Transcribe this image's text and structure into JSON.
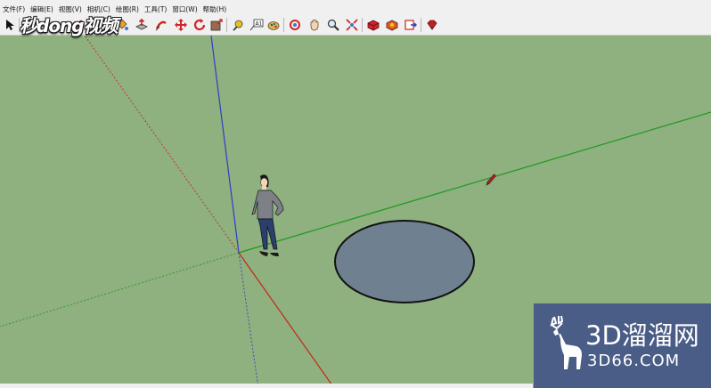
{
  "menu": {
    "items": [
      {
        "label": "文件(F)"
      },
      {
        "label": "编辑(E)"
      },
      {
        "label": "视图(V)"
      },
      {
        "label": "相机(C)"
      },
      {
        "label": "绘图(R)"
      },
      {
        "label": "工具(T)"
      },
      {
        "label": "窗口(W)"
      },
      {
        "label": "帮助(H)"
      }
    ]
  },
  "toolbar": {
    "tools": [
      {
        "icon": "select-arrow-icon"
      },
      {
        "icon": "eraser-icon"
      },
      {
        "icon": "paint-bucket-icon"
      },
      {
        "icon": "push-pull-icon"
      },
      {
        "icon": "follow-me-icon"
      },
      {
        "icon": "move-icon"
      },
      {
        "icon": "rotate-icon"
      },
      {
        "icon": "scale-icon"
      },
      {
        "icon": "tape-measure-icon"
      },
      {
        "icon": "text-label-icon"
      },
      {
        "icon": "paint-icon"
      },
      {
        "icon": "orbit-icon"
      },
      {
        "icon": "pan-icon"
      },
      {
        "icon": "zoom-icon"
      },
      {
        "icon": "zoom-extents-icon"
      },
      {
        "icon": "warehouse-icon"
      },
      {
        "icon": "extension-warehouse-icon"
      },
      {
        "icon": "send-to-layout-icon"
      },
      {
        "icon": "ruby-console-icon"
      }
    ]
  },
  "colors": {
    "sky_ground": "#8fb07f",
    "axis_red": "#c8261b",
    "axis_green": "#1f9a1f",
    "axis_blue": "#2c3fc8",
    "circle_face": "#6f8090",
    "watermark_panel": "#4a5d87"
  },
  "watermarks": {
    "top_left": "秒dong视频",
    "brand": "3D溜溜网",
    "domain": "3D66.COM"
  }
}
